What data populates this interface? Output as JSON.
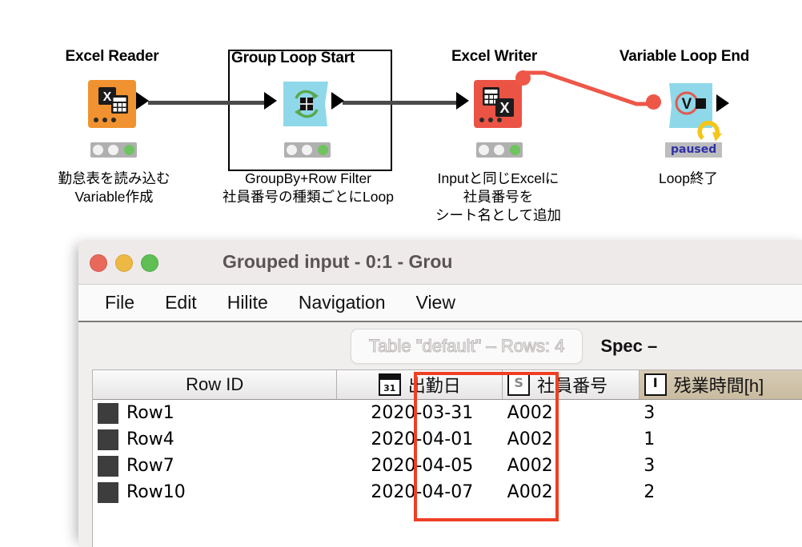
{
  "workflow": {
    "nodes": [
      {
        "title": "Excel Reader",
        "icon": "excel-reader-icon",
        "color": "#f0922f",
        "desc_lines": [
          "勤怠表を読み込む",
          "Variable作成"
        ],
        "status": "executed"
      },
      {
        "title": "Group Loop Start",
        "icon": "group-loop-start-icon",
        "color": "#8ed8ea",
        "desc_lines": [
          "GroupBy+Row Filter",
          "社員番号の種類ごとにLoop"
        ],
        "status": "executed"
      },
      {
        "title": "Excel Writer",
        "icon": "excel-writer-icon",
        "color": "#eb5345",
        "desc_lines": [
          "Inputと同じExcelに",
          "社員番号を",
          "シート名として追加"
        ],
        "status": "executed"
      },
      {
        "title": "Variable Loop End",
        "icon": "variable-loop-end-icon",
        "color": "#8ed8ea",
        "desc_lines": [
          "Loop終了"
        ],
        "badge": "paused",
        "status": "paused"
      }
    ],
    "colors": {
      "data_wire": "#4a4a4a",
      "flow_variable_wire": "#ee5748",
      "highlight": "#ee3f23"
    }
  },
  "window": {
    "title": "Grouped input - 0:1 - Grou",
    "traffic_lights": [
      "close-button",
      "minimize-button",
      "zoom-button"
    ],
    "menu": [
      "File",
      "Edit",
      "Hilite",
      "Navigation",
      "View"
    ],
    "tabs": [
      {
        "label": "Table \"default\" – Rows: 4",
        "active": true
      },
      {
        "label": "Spec –",
        "active": false
      }
    ]
  },
  "table": {
    "columns": [
      {
        "label": "Row ID",
        "icon": "",
        "selected": false
      },
      {
        "label": "出勤日",
        "icon": "date-icon",
        "icon_text": "31",
        "selected": false
      },
      {
        "label": "社員番号",
        "icon": "string-icon",
        "icon_text": "S",
        "selected": false
      },
      {
        "label": "残業時間[h]",
        "icon": "integer-icon",
        "icon_text": "I",
        "selected": true
      }
    ],
    "rows": [
      {
        "row_id": "Row1",
        "date": "2020-03-31",
        "employee_no": "A002",
        "overtime": "3"
      },
      {
        "row_id": "Row4",
        "date": "2020-04-01",
        "employee_no": "A002",
        "overtime": "1"
      },
      {
        "row_id": "Row7",
        "date": "2020-04-05",
        "employee_no": "A002",
        "overtime": "3"
      },
      {
        "row_id": "Row10",
        "date": "2020-04-07",
        "employee_no": "A002",
        "overtime": "2"
      }
    ],
    "highlighted_column": "社員番号"
  }
}
